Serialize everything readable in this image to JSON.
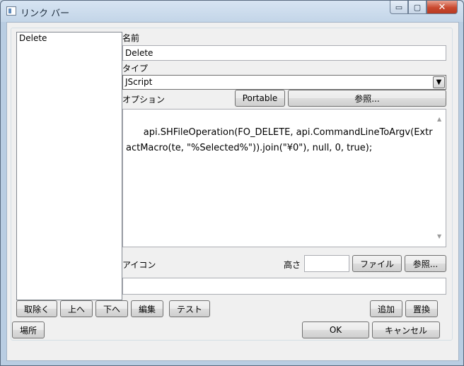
{
  "window": {
    "title": "リンク バー",
    "minimize": "▭",
    "maximize": "▢",
    "close": "✕"
  },
  "list": {
    "items": [
      "Delete"
    ]
  },
  "form": {
    "name_label": "名前",
    "name_value": "Delete",
    "type_label": "タイプ",
    "type_value": "JScript",
    "type_arrow": "▼",
    "options_label": "オプション",
    "portable_label": "Portable",
    "browse_label": "参照...",
    "script": "api.SHFileOperation(FO_DELETE, api.CommandLineToArgv(ExtractMacro(te, \"%Selected%\")).join(\"¥0\"), null, 0, true);",
    "icon_label": "アイコン",
    "height_label": "高さ",
    "height_value": "",
    "file_label": "ファイル",
    "icon_browse_label": "参照...",
    "icon_value": ""
  },
  "list_buttons": {
    "remove": "取除く",
    "up": "上へ",
    "down": "下へ",
    "edit": "編集",
    "test": "テスト"
  },
  "item_buttons": {
    "add": "追加",
    "replace": "置換"
  },
  "footer": {
    "location": "場所",
    "ok": "OK",
    "cancel": "キャンセル"
  },
  "scroll": {
    "up": "▲",
    "down": "▼"
  }
}
